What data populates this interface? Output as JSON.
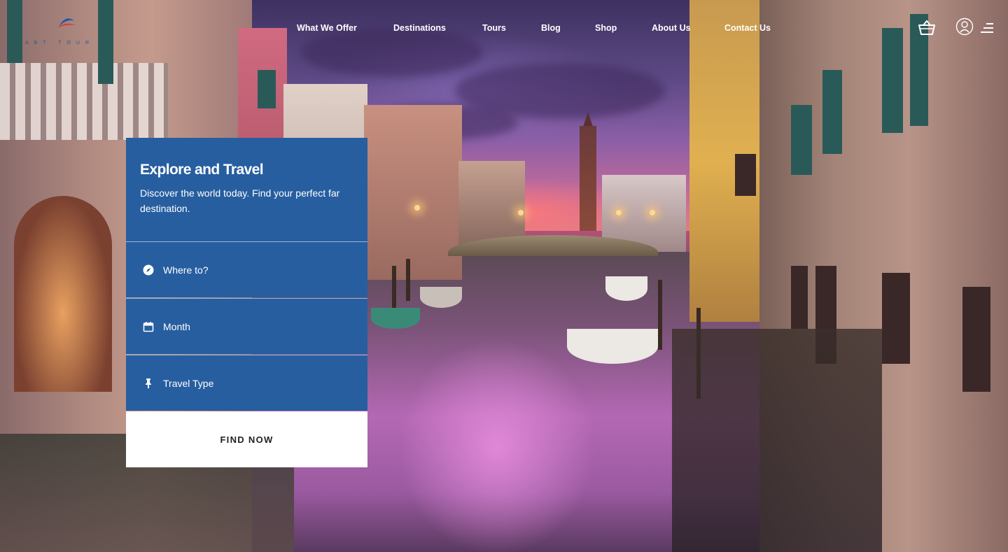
{
  "brand": {
    "logo_text": "ABT TOUR",
    "accent": "#275ea0",
    "logo_red": "#d23a3a"
  },
  "nav": {
    "items": [
      "What We Offer",
      "Destinations",
      "Tours",
      "Blog",
      "Shop",
      "About Us",
      "Contact Us"
    ]
  },
  "header_icons": [
    "basket-icon",
    "user-icon",
    "hamburger-menu-icon"
  ],
  "search_panel": {
    "title": "Explore and Travel",
    "subtitle": "Discover the world today. Find your perfect far destination.",
    "fields": [
      {
        "label": "Where to?",
        "icon": "compass-icon"
      },
      {
        "label": "Month",
        "icon": "calendar-icon"
      },
      {
        "label": "Travel Type",
        "icon": "pin-icon"
      }
    ],
    "button_label": "FIND NOW",
    "panel_color": "#275ea0"
  }
}
